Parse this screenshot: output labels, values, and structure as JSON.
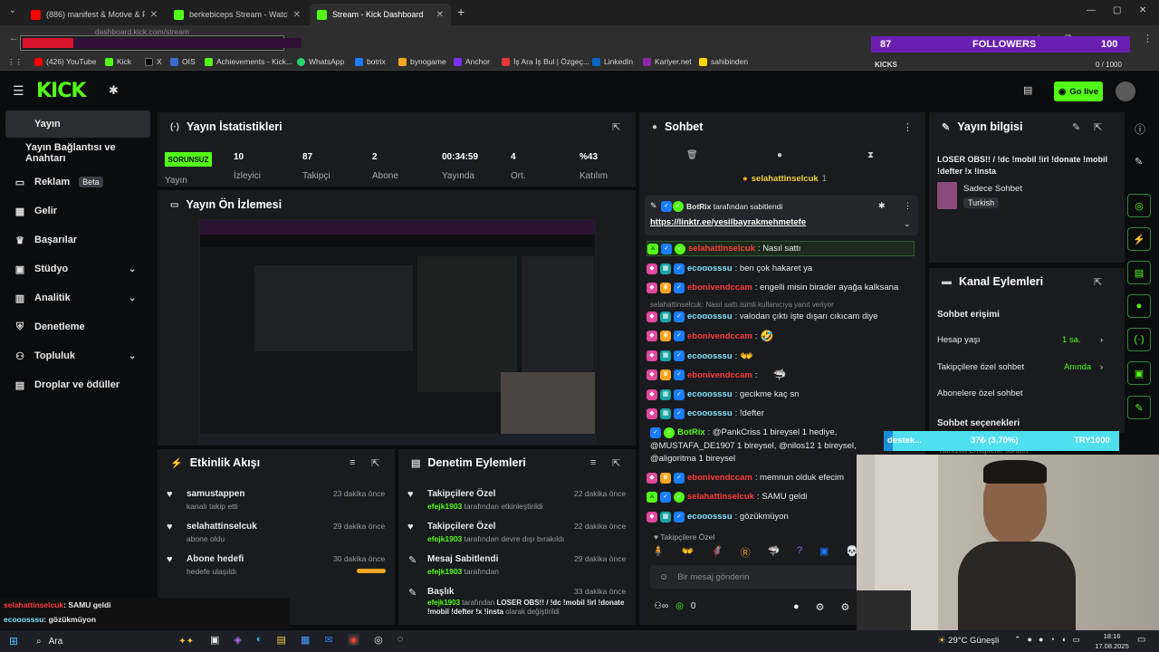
{
  "browser": {
    "tabs": [
      {
        "label": "(886) manifest & Motive & Pa..."
      },
      {
        "label": "berkebiceps Stream - Watch Li..."
      },
      {
        "label": "Stream - Kick Dashboard"
      }
    ],
    "url": "dashboard.kick.com/stream",
    "bookmarks": [
      "(426) YouTube",
      "Kick",
      "X",
      "OIS",
      "Achievements - Kick...",
      "WhatsApp",
      "botrix",
      "bynogame",
      "Anchor",
      "İş Ara İş Bul | Özgeç...",
      "LinkedIn",
      "Kariyer.net",
      "sahibinden"
    ]
  },
  "overlay": {
    "followers_count": "87",
    "followers_label": "FOLLOWERS",
    "followers_goal": "100",
    "kicks_label": "KICKS",
    "kicks_value": "0 / 1000",
    "donation_label": "destek...",
    "donation_progress": "37₺ (3,70%)",
    "donation_goal": "TRY1000",
    "donation_fraction": 0.037,
    "webcam_chat": [
      {
        "user": "selahattinselcuk",
        "text": ": SAMU geldi"
      },
      {
        "user": "ecooosssu",
        "text": ": gözükmüyon"
      }
    ]
  },
  "header": {
    "go_live_label": "Go live"
  },
  "sidebar": {
    "items": [
      {
        "label": "Yayın"
      },
      {
        "label": "Yayın Bağlantısı ve Anahtarı"
      },
      {
        "label": "Reklam",
        "badge": "Beta"
      },
      {
        "label": "Gelir"
      },
      {
        "label": "Başarılar"
      },
      {
        "label": "Stüdyo"
      },
      {
        "label": "Analitik"
      },
      {
        "label": "Denetleme"
      },
      {
        "label": "Topluluk"
      },
      {
        "label": "Droplar ve ödüller"
      }
    ]
  },
  "stats": {
    "title": "Yayın İstatistikleri",
    "status": "SORUNSUZ",
    "status_label": "Yayın",
    "items": [
      {
        "value": "10",
        "label": "İzleyici"
      },
      {
        "value": "87",
        "label": "Takipçi"
      },
      {
        "value": "2",
        "label": "Abone"
      },
      {
        "value": "00:34:59",
        "label": "Yayında"
      },
      {
        "value": "4",
        "label": "Ort."
      },
      {
        "value": "%43",
        "label": "Katılım"
      }
    ]
  },
  "preview": {
    "title": "Yayın Ön İzlemesi"
  },
  "activity": {
    "title": "Etkinlik Akışı",
    "items": [
      {
        "name": "samustappen",
        "sub": "kanalı takip etti",
        "time": "23 dakika önce"
      },
      {
        "name": "selahattinselcuk",
        "sub": "abone oldu",
        "time": "29 dakika önce"
      },
      {
        "name": "Abone hedefi",
        "sub": "hedefe ulaşıldı",
        "time": "30 dakika önce"
      }
    ]
  },
  "moderation": {
    "title": "Denetim Eylemleri",
    "items": [
      {
        "name": "Takipçilere Özel",
        "user": "efejk1903",
        "sub": "tarafından etkinleştirildi",
        "time": "22 dakika önce"
      },
      {
        "name": "Takipçilere Özel",
        "user": "efejk1903",
        "sub": "tarafından devre dışı bırakıldı",
        "time": "22 dakika önce"
      },
      {
        "name": "Mesaj Sabitlendi",
        "user": "efejk1903",
        "sub": "tarafından",
        "time": "29 dakika önce"
      },
      {
        "name": "Başlık",
        "user": "efejk1903",
        "sub": "tarafından",
        "extra": "LOSER OBS!! / !dc !mobil !irl !donate !mobil !defter !x !insta",
        "extra2": "olarak değiştirildi",
        "time": "33 dakika önce"
      }
    ]
  },
  "chat": {
    "title": "Sohbet",
    "pinned_header_user": "selahattinselcuk",
    "pinned_header_count": "1",
    "pinned_by": "BotRix",
    "pinned_by_suffix": "tarafından sabitlendi",
    "pinned_link": "https://linktr.ee/yesilbayrakmehmetefe",
    "reply_context": "selahattinselcuk: Nasıl sattı isimli kullanıcıya yanıt veriyor",
    "messages": [
      {
        "user": "selahattinselcuk",
        "text": ": Nasıl sattı",
        "color": "u-red"
      },
      {
        "user": "ecooosssu",
        "text": ": ben çok hakaret ya",
        "color": "u-cyan"
      },
      {
        "user": "ebonivendccam",
        "text": ": engelli misin birader ayağa kalksana",
        "color": "u-red"
      },
      {
        "user": "ecooosssu",
        "text": ": valodan çıktı işte dışarı cıkıcam diye",
        "color": "u-cyan"
      },
      {
        "user": "ebonivendccam",
        "text": ":",
        "color": "u-red",
        "emote": "🤣"
      },
      {
        "user": "ecooosssu",
        "text": ":",
        "color": "u-cyan",
        "emote": "👐"
      },
      {
        "user": "ebonivendccam",
        "text": ":",
        "color": "u-red",
        "emote": "🦈"
      },
      {
        "user": "ecooosssu",
        "text": ": gecikme kaç sn",
        "color": "u-cyan"
      },
      {
        "user": "ecooosssu",
        "text": ": !defter",
        "color": "u-cyan"
      }
    ],
    "botrix_msg": {
      "user": "BotRix",
      "line1": ": @PankCriss 1 bireysel 1 hediye,",
      "line2": "@MUSTAFA_DE1907 1 bireysel, @nilos12 1 bireysel,",
      "line3": "@aligoritma 1 bireysel"
    },
    "messages2": [
      {
        "user": "ebonivendccam",
        "text": ": memnun olduk efecim",
        "color": "u-red"
      },
      {
        "user": "selahattinselcuk",
        "text": ": SAMU geldi",
        "color": "u-red"
      },
      {
        "user": "ecooosssu",
        "text": ": gözükmüyon",
        "color": "u-cyan"
      }
    ],
    "followers_only_label": "Takipçilere Özel",
    "input_placeholder": "Bir mesaj gönderin",
    "points": "0"
  },
  "stream_info": {
    "title": "Yayın bilgisi",
    "stream_title": "LOSER OBS!! / !dc !mobil !irl !donate !mobil !defter !x !insta",
    "category": "Sadece Sohbet",
    "language": "Turkish"
  },
  "channel_actions": {
    "title": "Kanal Eylemleri",
    "section": "Sohbet erişimi",
    "rows": [
      {
        "label": "Hesap yaşı",
        "value": "1 sa."
      },
      {
        "label": "Takipçilere özel sohbet",
        "value": "Anında"
      },
      {
        "label": "Abonelere özel sohbet",
        "value": ""
      }
    ],
    "section2": "Sohbet seçenekleri",
    "row_cut": "Yalnızca Emojilerle sohbet"
  },
  "taskbar": {
    "search": "Ara",
    "weather": "29°C  Güneşli",
    "time": "18:16",
    "date": "17.08.2025"
  }
}
